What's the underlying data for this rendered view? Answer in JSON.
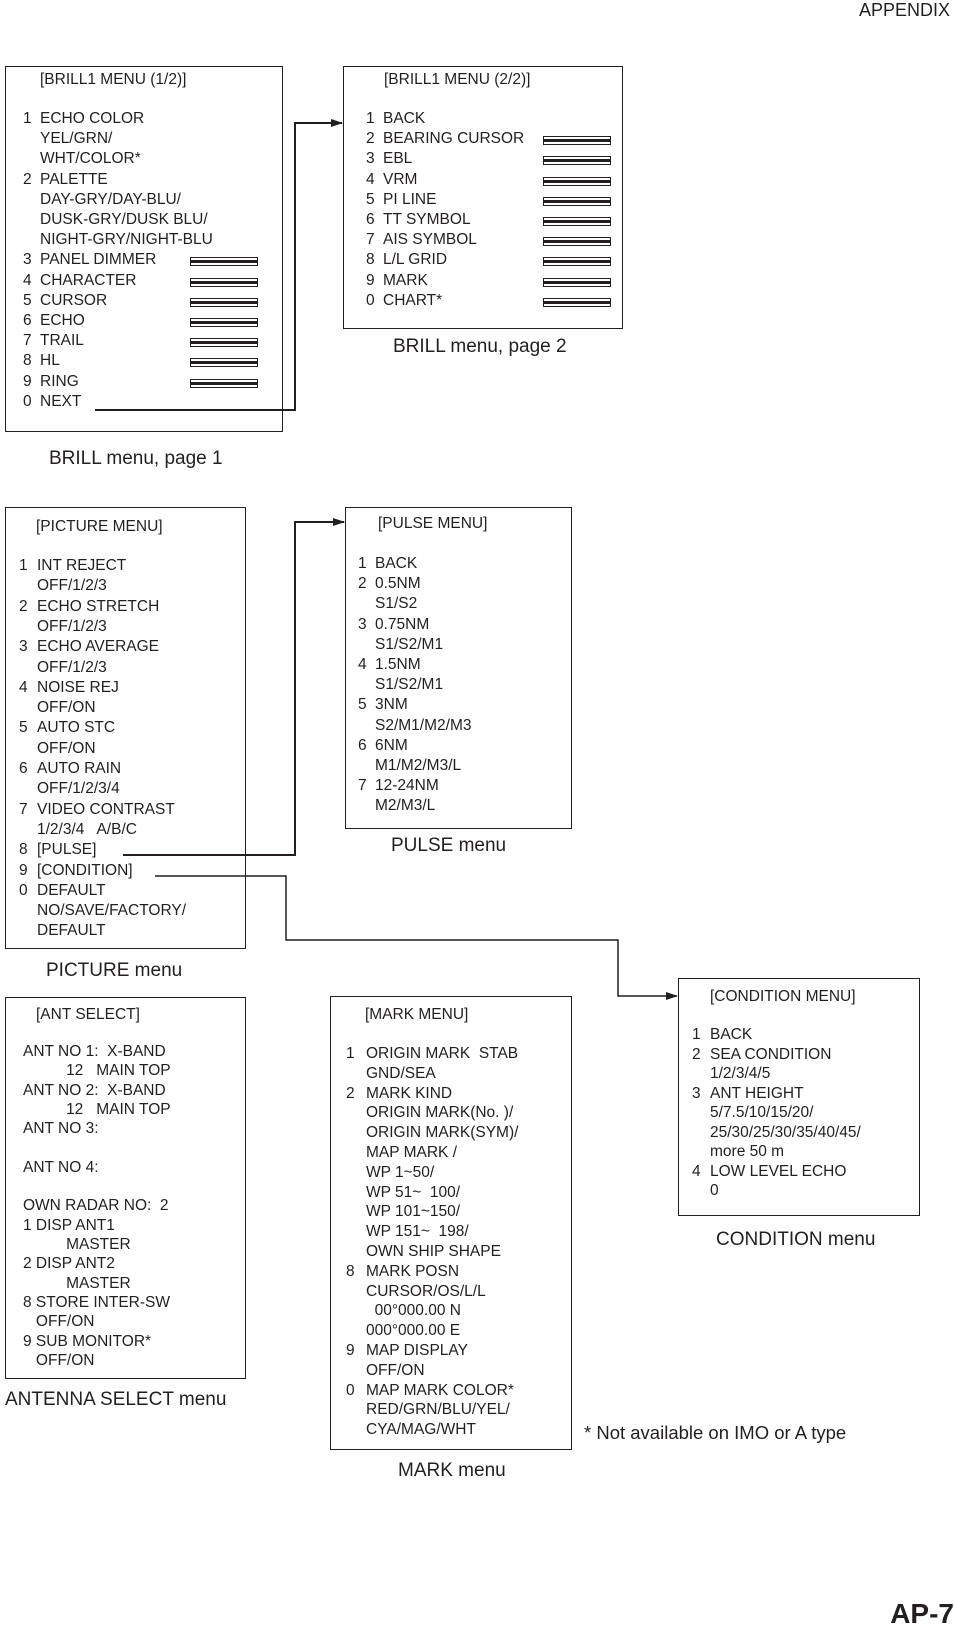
{
  "page": {
    "header": "APPENDIX",
    "footer": "AP-7",
    "footnote": "* Not available on IMO or A type"
  },
  "brill1": {
    "title": "[BRILL1 MENU (1/2)]",
    "caption": "BRILL menu, page 1",
    "lines": [
      {
        "num": "1",
        "text": "ECHO COLOR",
        "bar": false
      },
      {
        "num": "",
        "text": "YEL/GRN/",
        "bar": false
      },
      {
        "num": "",
        "text": "WHT/COLOR*",
        "bar": false
      },
      {
        "num": "2",
        "text": "PALETTE",
        "bar": false
      },
      {
        "num": "",
        "text": "DAY-GRY/DAY-BLU/",
        "bar": false
      },
      {
        "num": "",
        "text": "DUSK-GRY/DUSK BLU/",
        "bar": false
      },
      {
        "num": "",
        "text": "NIGHT-GRY/NIGHT-BLU",
        "bar": false
      },
      {
        "num": "3",
        "text": "PANEL DIMMER",
        "bar": true
      },
      {
        "num": "4",
        "text": "CHARACTER",
        "bar": true
      },
      {
        "num": "5",
        "text": "CURSOR",
        "bar": true
      },
      {
        "num": "6",
        "text": "ECHO",
        "bar": true
      },
      {
        "num": "7",
        "text": "TRAIL",
        "bar": true
      },
      {
        "num": "8",
        "text": "HL",
        "bar": true
      },
      {
        "num": "9",
        "text": "RING",
        "bar": true
      },
      {
        "num": "0",
        "text": "NEXT",
        "bar": false
      }
    ]
  },
  "brill2": {
    "title": "[BRILL1 MENU (2/2)]",
    "caption": "BRILL menu, page 2",
    "lines": [
      {
        "num": "1",
        "text": "BACK",
        "bar": false
      },
      {
        "num": "2",
        "text": "BEARING CURSOR",
        "bar": true
      },
      {
        "num": "3",
        "text": "EBL",
        "bar": true
      },
      {
        "num": "4",
        "text": "VRM",
        "bar": true
      },
      {
        "num": "5",
        "text": "PI LINE",
        "bar": true
      },
      {
        "num": "6",
        "text": "TT SYMBOL",
        "bar": true
      },
      {
        "num": "7",
        "text": "AIS SYMBOL",
        "bar": true
      },
      {
        "num": "8",
        "text": "L/L GRID",
        "bar": true
      },
      {
        "num": "9",
        "text": "MARK",
        "bar": true
      },
      {
        "num": "0",
        "text": "CHART*",
        "bar": true
      }
    ]
  },
  "picture": {
    "title": "[PICTURE MENU]",
    "caption": "PICTURE menu",
    "lines": [
      {
        "num": "1",
        "text": "INT REJECT"
      },
      {
        "num": "",
        "text": "OFF/1/2/3"
      },
      {
        "num": "2",
        "text": "ECHO STRETCH"
      },
      {
        "num": "",
        "text": "OFF/1/2/3"
      },
      {
        "num": "3",
        "text": "ECHO AVERAGE"
      },
      {
        "num": "",
        "text": "OFF/1/2/3"
      },
      {
        "num": "4",
        "text": "NOISE REJ"
      },
      {
        "num": "",
        "text": "OFF/ON"
      },
      {
        "num": "5",
        "text": "AUTO STC"
      },
      {
        "num": "",
        "text": "OFF/ON"
      },
      {
        "num": "6",
        "text": "AUTO RAIN"
      },
      {
        "num": "",
        "text": "OFF/1/2/3/4"
      },
      {
        "num": "7",
        "text": "VIDEO CONTRAST"
      },
      {
        "num": "",
        "text": "1/2/3/4   A/B/C"
      },
      {
        "num": "8",
        "text": "[PULSE]"
      },
      {
        "num": "9",
        "text": "[CONDITION]"
      },
      {
        "num": "0",
        "text": "DEFAULT"
      },
      {
        "num": "",
        "text": "NO/SAVE/FACTORY/"
      },
      {
        "num": "",
        "text": "DEFAULT"
      }
    ]
  },
  "pulse": {
    "title": "[PULSE MENU]",
    "caption": "PULSE menu",
    "lines": [
      {
        "num": "1",
        "text": "BACK"
      },
      {
        "num": "2",
        "text": "0.5NM"
      },
      {
        "num": "",
        "text": "S1/S2"
      },
      {
        "num": "3",
        "text": "0.75NM"
      },
      {
        "num": "",
        "text": "S1/S2/M1"
      },
      {
        "num": "4",
        "text": "1.5NM"
      },
      {
        "num": "",
        "text": "S1/S2/M1"
      },
      {
        "num": "5",
        "text": "3NM"
      },
      {
        "num": "",
        "text": "S2/M1/M2/M3"
      },
      {
        "num": "6",
        "text": "6NM"
      },
      {
        "num": "",
        "text": "M1/M2/M3/L"
      },
      {
        "num": "7",
        "text": "12-24NM"
      },
      {
        "num": "",
        "text": "M2/M3/L"
      }
    ]
  },
  "condition": {
    "title": "[CONDITION MENU]",
    "caption": "CONDITION menu",
    "lines": [
      {
        "num": "1",
        "text": "BACK"
      },
      {
        "num": "2",
        "text": "SEA CONDITION"
      },
      {
        "num": "",
        "text": "1/2/3/4/5"
      },
      {
        "num": "3",
        "text": "ANT HEIGHT"
      },
      {
        "num": "",
        "text": "5/7.5/10/15/20/"
      },
      {
        "num": "",
        "text": "25/30/25/30/35/40/45/"
      },
      {
        "num": "",
        "text": "more 50 m"
      },
      {
        "num": "4",
        "text": "LOW LEVEL ECHO"
      },
      {
        "num": "",
        "text": "0"
      }
    ]
  },
  "antenna": {
    "title": "[ANT SELECT]",
    "caption": "ANTENNA SELECT menu",
    "lines": [
      {
        "text": "ANT NO 1:  X-BAND"
      },
      {
        "text": "          12   MAIN TOP"
      },
      {
        "text": "ANT NO 2:  X-BAND"
      },
      {
        "text": "          12   MAIN TOP"
      },
      {
        "text": "ANT NO 3:"
      },
      {
        "text": ""
      },
      {
        "text": "ANT NO 4:"
      },
      {
        "text": ""
      },
      {
        "text": "OWN RADAR NO:  2"
      },
      {
        "text": "1 DISP ANT1"
      },
      {
        "text": "          MASTER"
      },
      {
        "text": "2 DISP ANT2"
      },
      {
        "text": "          MASTER"
      },
      {
        "text": "8 STORE INTER-SW"
      },
      {
        "text": "   OFF/ON"
      },
      {
        "text": "9 SUB MONITOR*"
      },
      {
        "text": "   OFF/ON"
      }
    ]
  },
  "mark": {
    "title": "[MARK MENU]",
    "caption": "MARK menu",
    "lines": [
      {
        "num": "1",
        "text": "ORIGIN MARK  STAB"
      },
      {
        "num": "",
        "text": "GND/SEA"
      },
      {
        "num": "2",
        "text": "MARK KIND"
      },
      {
        "num": "",
        "text": "ORIGIN MARK(No. )/"
      },
      {
        "num": "",
        "text": "ORIGIN MARK(SYM)/"
      },
      {
        "num": "",
        "text": "MAP MARK /"
      },
      {
        "num": "",
        "text": "WP 1~50/"
      },
      {
        "num": "",
        "text": "WP 51~  100/"
      },
      {
        "num": "",
        "text": "WP 101~150/"
      },
      {
        "num": "",
        "text": "WP 151~  198/"
      },
      {
        "num": "",
        "text": "OWN SHIP SHAPE"
      },
      {
        "num": "8",
        "text": "MARK POSN"
      },
      {
        "num": "",
        "text": "CURSOR/OS/L/L"
      },
      {
        "num": "",
        "text": "  00°000.00 N"
      },
      {
        "num": "",
        "text": "000°000.00 E"
      },
      {
        "num": "9",
        "text": "MAP DISPLAY"
      },
      {
        "num": "",
        "text": "OFF/ON"
      },
      {
        "num": "0",
        "text": "MAP MARK COLOR*"
      },
      {
        "num": "",
        "text": "RED/GRN/BLU/YEL/"
      },
      {
        "num": "",
        "text": "CYA/MAG/WHT"
      }
    ]
  }
}
